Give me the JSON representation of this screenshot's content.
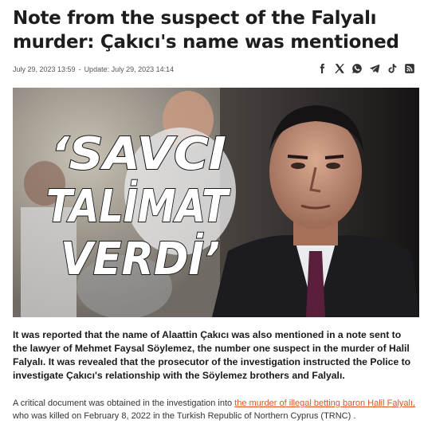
{
  "article": {
    "title": "Note from the suspect of the Falyalı murder: Çakıcı's name was mentioned",
    "published": "July 29, 2023 13:59",
    "separator": "-",
    "updated": "Update: July 29, 2023 14:14"
  },
  "share_icons": [
    "facebook-icon",
    "x-icon",
    "whatsapp-icon",
    "telegram-icon",
    "tiktok-icon",
    "rss-icon"
  ],
  "hero": {
    "headline_lines": [
      "‘SAVCI",
      "TALİMAT",
      "VERDİ’"
    ]
  },
  "lead": "It was reported that the name of Alaattin Çakıcı was also mentioned in a note sent to the lawyer of Mehmet Faysal Söylemez, the number one suspect in the murder of Halil Falyalı. It was revealed that the prosecutor of the investigation instructed the Police to investigate Çakıcı's relationship with the Söylemez brothers and Falyalı.",
  "body": {
    "before_link": "A critical document was obtained in the investigation into ",
    "link_text": "the murder of illegal betting baron Halil Falyalı,",
    "after_link": " who was killed on February 8, 2022 in the Turkish Republic of Northern Cyprus (TRNC) ."
  },
  "colors": {
    "link": "#e0542b",
    "title": "#1d1d1d"
  }
}
